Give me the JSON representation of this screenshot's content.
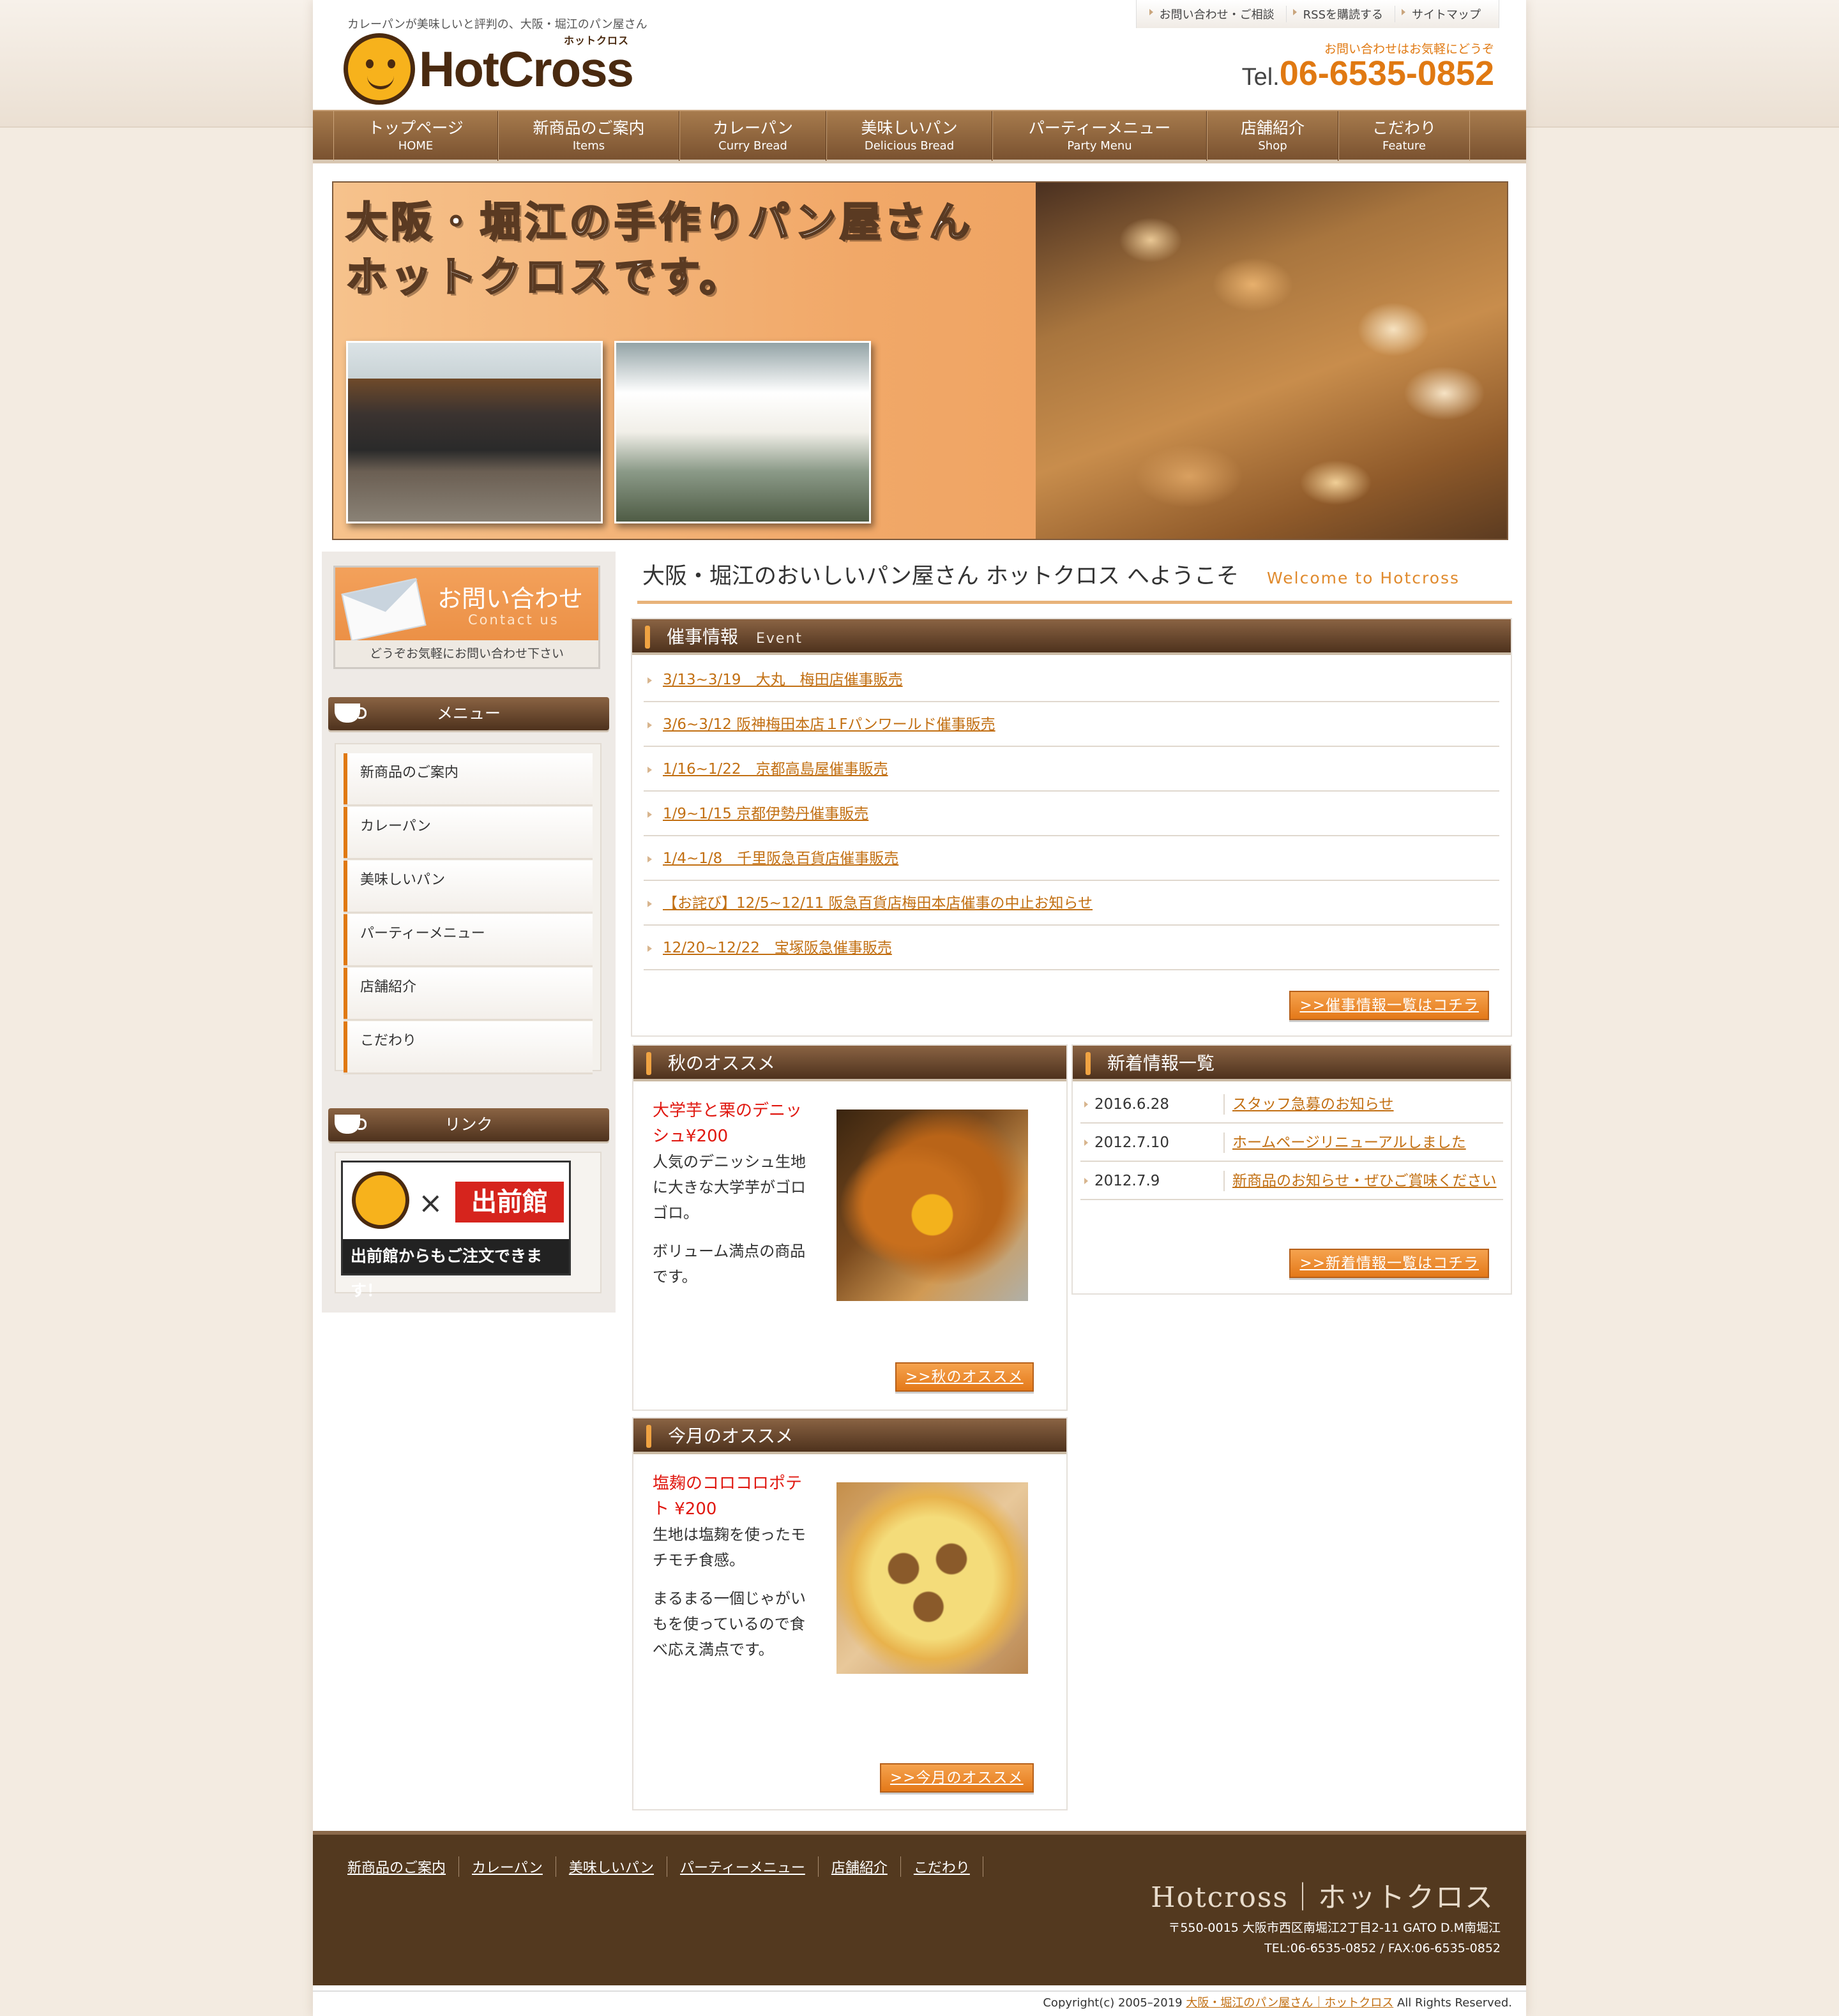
{
  "header": {
    "tagline": "カレーパンが美味しいと評判の、大阪・堀江のパン屋さん",
    "logo_text": "HotCross",
    "logo_kana": "ホットクロス",
    "top_links": [
      "お問い合わせ・ご相談",
      "RSSを購読する",
      "サイトマップ"
    ],
    "tel_note": "お問い合わせはお気軽にどうぞ",
    "tel_prefix": "Tel.",
    "tel_number": "06-6535-0852"
  },
  "nav": [
    {
      "jp": "トップページ",
      "en": "HOME"
    },
    {
      "jp": "新商品のご案内",
      "en": "Items"
    },
    {
      "jp": "カレーパン",
      "en": "Curry Bread"
    },
    {
      "jp": "美味しいパン",
      "en": "Delicious Bread"
    },
    {
      "jp": "パーティーメニュー",
      "en": "Party Menu"
    },
    {
      "jp": "店舗紹介",
      "en": "Shop"
    },
    {
      "jp": "こだわり",
      "en": "Feature"
    }
  ],
  "hero": {
    "line1": "大阪・堀江の手作りパン屋さん",
    "line2": "ホットクロスです。"
  },
  "sidebar": {
    "contact_title": "お問い合わせ",
    "contact_en": "Contact us",
    "contact_note": "どうぞお気軽にお問い合わせ下さい",
    "menu_title": "メニュー",
    "menu_items": [
      "新商品のご案内",
      "カレーパン",
      "美味しいパン",
      "パーティーメニュー",
      "店舗紹介",
      "こだわり"
    ],
    "link_title": "リンク",
    "demae_logo": "出前館",
    "demae_x": "×",
    "demae_banner": "出前館からもご注文できます！"
  },
  "main": {
    "welcome_jp": "大阪・堀江のおいしいパン屋さん ホットクロス へようこそ",
    "welcome_en": "Welcome to Hotcross",
    "events": {
      "title": "催事情報",
      "sub": "Event",
      "items": [
        "3/13~3/19　大丸　梅田店催事販売",
        "3/6~3/12 阪神梅田本店１Fパンワールド催事販売",
        "1/16~1/22　京都高島屋催事販売",
        "1/9~1/15 京都伊勢丹催事販売",
        "1/4~1/8　千里阪急百貨店催事販売",
        "【お詫び】12/5~12/11 阪急百貨店梅田本店催事の中止お知らせ",
        "12/20~12/22　宝塚阪急催事販売"
      ],
      "more": ">>催事情報一覧はコチラ"
    },
    "autumn": {
      "title": "秋のオススメ",
      "item_title": "大学芋と栗のデニッシュ¥200",
      "desc1": "人気のデニッシュ生地に大きな大学芋がゴロゴロ。",
      "desc2": "ボリューム満点の商品です。",
      "more": ">>秋のオススメ"
    },
    "monthly": {
      "title": "今月のオススメ",
      "item_title": "塩麹のコロコロポテト ¥200",
      "desc1": "生地は塩麹を使ったモチモチ食感。",
      "desc2": "まるまる一個じゃがいもを使っているので食べ応え満点です。",
      "more": ">>今月のオススメ"
    },
    "news": {
      "title": "新着情報一覧",
      "items": [
        {
          "date": "2016.6.28",
          "text": "スタッフ急募のお知らせ"
        },
        {
          "date": "2012.7.10",
          "text": "ホームページリニューアルしました"
        },
        {
          "date": "2012.7.9",
          "text": "新商品のお知らせ・ぜひご賞味ください"
        }
      ],
      "more": ">>新着情報一覧はコチラ"
    }
  },
  "footer": {
    "links": [
      "新商品のご案内",
      "カレーパン",
      "美味しいパン",
      "パーティーメニュー",
      "店舗紹介",
      "こだわり"
    ],
    "name": "Hotcross｜ホットクロス",
    "address": "〒550-0015 大阪市西区南堀江2丁目2-11 GATO D.M南堀江",
    "contact": "TEL:06-6535-0852 / FAX:06-6535-0852",
    "copy_pre": "Copyright(c) 2005–2019 ",
    "copy_link": "大阪・堀江のパン屋さん｜ホットクロス",
    "copy_post": " All Rights Reserved."
  },
  "colors": {
    "accent": "#e07912",
    "brown": "#53391f",
    "link": "#c26f12",
    "red": "#e0170f"
  },
  "icons": [
    "cup-icon",
    "envelope-icon",
    "arrow-icon"
  ]
}
